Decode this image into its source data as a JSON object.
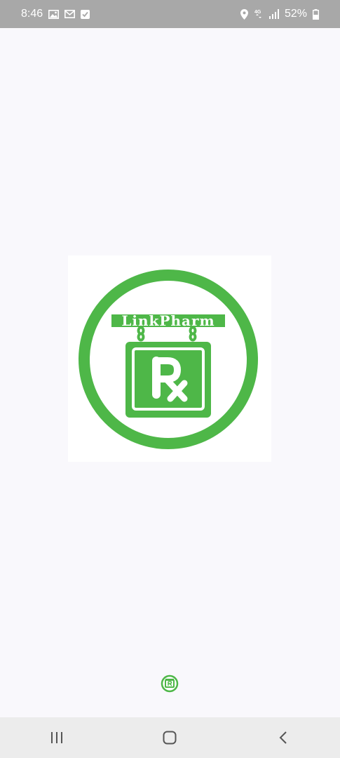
{
  "status_bar": {
    "time": "8:46",
    "battery": "52%",
    "network": "4G",
    "left_icons": [
      "image-icon",
      "mail-icon",
      "checkbox-icon"
    ],
    "right_icons": [
      "location-icon",
      "network-icon",
      "signal-icon",
      "battery-icon"
    ]
  },
  "splash": {
    "brand_name": "LinkPharm",
    "symbol": "Rx",
    "logo_color": "#4eb748",
    "background": "#f9f8fc"
  },
  "navigation_bar": {
    "buttons": [
      "recent-apps",
      "home",
      "back"
    ]
  }
}
